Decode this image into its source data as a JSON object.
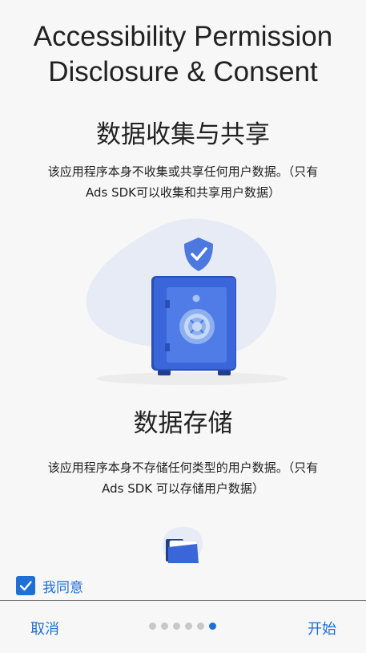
{
  "header": {
    "title_line1": "Accessibility Permission",
    "title_line2": "Disclosure & Consent"
  },
  "section1": {
    "heading": "数据收集与共享",
    "text_line1": "该应用程序本身不收集或共享任何用户数据。（只有",
    "text_line2": "Ads SDK可以收集和共享用户数据）",
    "illustration": "safe-with-shield-icon"
  },
  "section2": {
    "heading": "数据存储",
    "text_line1": "该应用程序本身不存储任何类型的用户数据。（只有",
    "text_line2": "Ads SDK 可以存储用户数据）",
    "illustration": "folder-icon"
  },
  "consent": {
    "label": "我同意",
    "checked": true
  },
  "footer": {
    "cancel_label": "取消",
    "start_label": "开始",
    "page_count": 6,
    "current_page": 6
  },
  "colors": {
    "accent": "#1f6fd6",
    "safe_blue": "#3a66d9",
    "blob": "#e6ebf5"
  }
}
